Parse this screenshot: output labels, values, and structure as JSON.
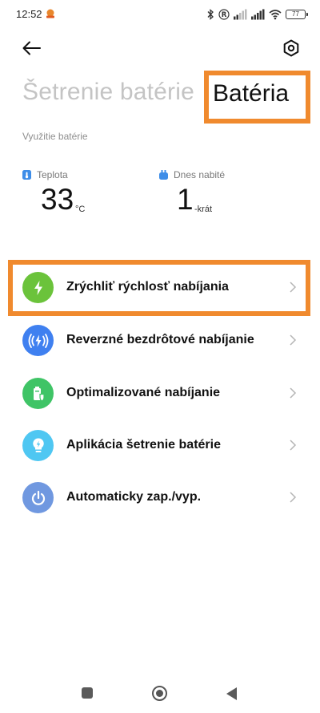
{
  "status_bar": {
    "time": "12:52",
    "battery_level": "77",
    "icons": [
      "notification-icon",
      "bluetooth-icon",
      "registered-icon",
      "signal-icon",
      "signal-icon",
      "wifi-icon",
      "battery-icon"
    ]
  },
  "header": {
    "back_icon": "arrow-left-icon",
    "settings_icon": "hexagon-gear-icon",
    "tabs": [
      {
        "label": "Šetrenie batérie",
        "active": false
      },
      {
        "label": "Batéria",
        "active": true
      }
    ]
  },
  "usage": {
    "section_label": "Využitie batérie",
    "temperature": {
      "label": "Teplota",
      "value": "33",
      "unit": "°C"
    },
    "charged_today": {
      "label": "Dnes nabité",
      "value": "1",
      "unit": "-krát"
    }
  },
  "menu": {
    "items": [
      {
        "label": "Zrýchliť rýchlosť nabíjania",
        "icon": "lightning-icon",
        "color": "#6bc33b"
      },
      {
        "label": "Reverzné bezdrôtové nabíjanie",
        "icon": "wireless-charging-icon",
        "color": "#3f80f0"
      },
      {
        "label": "Optimalizované nabíjanie",
        "icon": "battery-shield-icon",
        "color": "#3fc466"
      },
      {
        "label": "Aplikácia šetrenie batérie",
        "icon": "lightbulb-icon",
        "color": "#4fc7f2"
      },
      {
        "label": "Automaticky zap./vyp.",
        "icon": "power-icon",
        "color": "#7098e0"
      }
    ]
  },
  "colors": {
    "highlight": "#f08a2e",
    "inactive_tab": "#c4c4c4",
    "temperature_icon": "#3d8de8",
    "charge_icon": "#3d8de8"
  },
  "nav": {
    "icons": [
      "recents-icon",
      "home-icon",
      "back-triangle-icon"
    ]
  }
}
